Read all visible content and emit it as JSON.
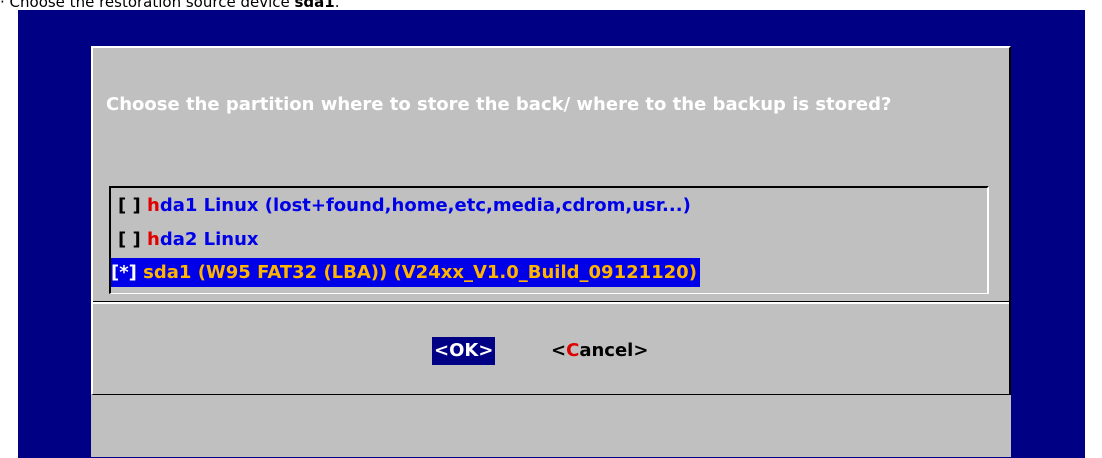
{
  "caption": {
    "prefix": "· Choose the restoration source device ",
    "device": "sda1",
    "suffix": "."
  },
  "dialog": {
    "prompt": "Choose the partition where to store the back/ where to the backup is stored?"
  },
  "partitions": [
    {
      "mark": "[ ]",
      "hotkey": "h",
      "rest": "da1 Linux (lost+found,home,etc,media,cdrom,usr...)",
      "selected": false
    },
    {
      "mark": "[ ]",
      "hotkey": "h",
      "rest": "da2 Linux",
      "selected": false
    },
    {
      "mark": "[*]",
      "text": "sda1 (W95 FAT32 (LBA)) (V24xx_V1.0_Build_09121120)",
      "selected": true
    }
  ],
  "buttons": {
    "ok": "<OK>",
    "cancel_open": "<",
    "cancel_hotkey": "C",
    "cancel_rest": "ancel>"
  },
  "colors": {
    "screen_bg": "#000085",
    "dialog_bg": "#c0c0c0",
    "item_text": "#0000e8",
    "hotkey": "#e00000",
    "selected_text": "#ffb400"
  }
}
